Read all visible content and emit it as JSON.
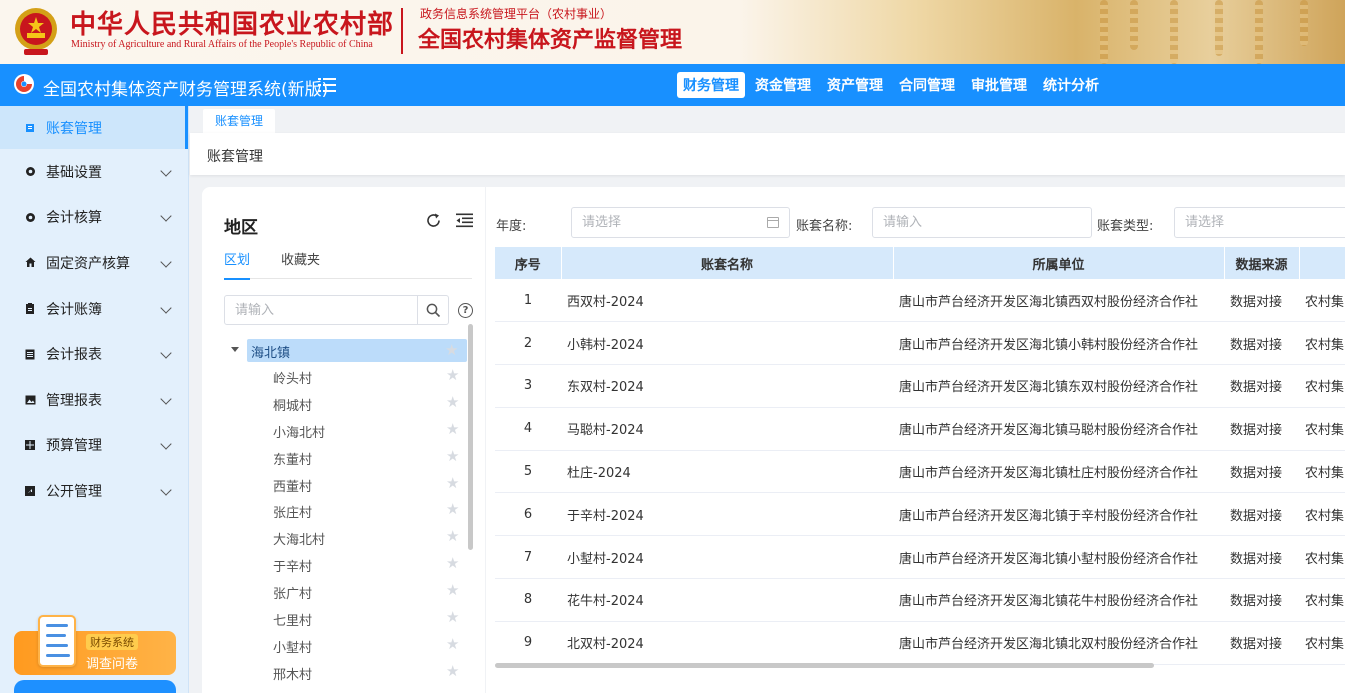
{
  "banner": {
    "ministry_cn": "中华人民共和国农业农村部",
    "ministry_en": "Ministry of Agriculture and Rural Affairs of the People's Republic of China",
    "platform_sub": "政务信息系统管理平台（农村事业）",
    "platform_main": "全国农村集体资产监督管理",
    "emblem_icon": "national-emblem-icon",
    "colors": {
      "brand_red": "#c8161d"
    }
  },
  "topnav": {
    "system_title": "全国农村集体资产财务管理系统(新版)",
    "menu": [
      {
        "label": "财务管理",
        "active": true
      },
      {
        "label": "资金管理",
        "active": false
      },
      {
        "label": "资产管理",
        "active": false
      },
      {
        "label": "合同管理",
        "active": false
      },
      {
        "label": "审批管理",
        "active": false
      },
      {
        "label": "统计分析",
        "active": false
      }
    ],
    "colors": {
      "accent": "#1890ff"
    }
  },
  "sidebar": {
    "items": [
      {
        "label": "账套管理",
        "icon": "book-icon",
        "active": true
      },
      {
        "label": "基础设置",
        "icon": "gear-icon",
        "active": false
      },
      {
        "label": "会计核算",
        "icon": "gear-icon",
        "active": false
      },
      {
        "label": "固定资产核算",
        "icon": "home-icon",
        "active": false
      },
      {
        "label": "会计账簿",
        "icon": "clipboard-icon",
        "active": false
      },
      {
        "label": "会计报表",
        "icon": "report-icon",
        "active": false
      },
      {
        "label": "管理报表",
        "icon": "image-report-icon",
        "active": false
      },
      {
        "label": "预算管理",
        "icon": "grid-icon",
        "active": false
      },
      {
        "label": "公开管理",
        "icon": "export-icon",
        "active": false
      }
    ],
    "survey": {
      "tag": "财务系统",
      "label": "调查问卷"
    }
  },
  "tabs": {
    "open_tab": "账套管理"
  },
  "breadcrumb": "账套管理",
  "region_panel": {
    "title": "地区",
    "subtabs": [
      {
        "label": "区划",
        "active": true
      },
      {
        "label": "收藏夹",
        "active": false
      }
    ],
    "search_placeholder": "请输入",
    "tree": {
      "root": "海北镇",
      "children": [
        "岭头村",
        "桐城村",
        "小海北村",
        "东董村",
        "西董村",
        "张庄村",
        "大海北村",
        "于辛村",
        "张广村",
        "七里村",
        "小堼村",
        "邢木村"
      ]
    }
  },
  "filters": {
    "year_label": "年度:",
    "year_placeholder": "请选择",
    "name_label": "账套名称:",
    "name_placeholder": "请输入",
    "type_label": "账套类型:",
    "type_placeholder": "请选择"
  },
  "table": {
    "columns": [
      "序号",
      "账套名称",
      "所属单位",
      "数据来源",
      ""
    ],
    "rows": [
      {
        "idx": "1",
        "name": "西双村-2024",
        "unit": "唐山市芦台经济开发区海北镇西双村股份经济合作社",
        "source": "数据对接",
        "type": "农村集"
      },
      {
        "idx": "2",
        "name": "小韩村-2024",
        "unit": "唐山市芦台经济开发区海北镇小韩村股份经济合作社",
        "source": "数据对接",
        "type": "农村集"
      },
      {
        "idx": "3",
        "name": "东双村-2024",
        "unit": "唐山市芦台经济开发区海北镇东双村股份经济合作社",
        "source": "数据对接",
        "type": "农村集"
      },
      {
        "idx": "4",
        "name": "马聪村-2024",
        "unit": "唐山市芦台经济开发区海北镇马聪村股份经济合作社",
        "source": "数据对接",
        "type": "农村集"
      },
      {
        "idx": "5",
        "name": "杜庄-2024",
        "unit": "唐山市芦台经济开发区海北镇杜庄村股份经济合作社",
        "source": "数据对接",
        "type": "农村集"
      },
      {
        "idx": "6",
        "name": "于辛村-2024",
        "unit": "唐山市芦台经济开发区海北镇于辛村股份经济合作社",
        "source": "数据对接",
        "type": "农村集"
      },
      {
        "idx": "7",
        "name": "小堼村-2024",
        "unit": "唐山市芦台经济开发区海北镇小堼村股份经济合作社",
        "source": "数据对接",
        "type": "农村集"
      },
      {
        "idx": "8",
        "name": "花牛村-2024",
        "unit": "唐山市芦台经济开发区海北镇花牛村股份经济合作社",
        "source": "数据对接",
        "type": "农村集"
      },
      {
        "idx": "9",
        "name": "北双村-2024",
        "unit": "唐山市芦台经济开发区海北镇北双村股份经济合作社",
        "source": "数据对接",
        "type": "农村集"
      }
    ]
  }
}
